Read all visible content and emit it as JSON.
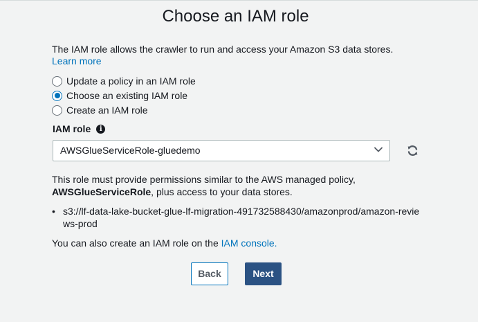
{
  "title": "Choose an IAM role",
  "intro": {
    "text": "The IAM role allows the crawler to run and access your Amazon S3 data stores.",
    "learn_more": "Learn more"
  },
  "options": [
    {
      "label": "Update a policy in an IAM role",
      "checked": false
    },
    {
      "label": "Choose an existing IAM role",
      "checked": true
    },
    {
      "label": "Create an IAM role",
      "checked": false
    }
  ],
  "iam_role": {
    "label": "IAM role",
    "info_icon": "info-icon",
    "selected": "AWSGlueServiceRole-gluedemo",
    "refresh_icon": "refresh-icon"
  },
  "permissions": {
    "text_before": "This role must provide permissions similar to the AWS managed policy,",
    "policy": "AWSGlueServiceRole",
    "text_after": ", plus access to your data stores.",
    "bullet_marker": "•",
    "path": "s3://lf-data-lake-bucket-glue-lf-migration-491732588430/amazonprod/amazon-reviews-prod"
  },
  "console": {
    "text": "You can also create an IAM role on the ",
    "link": "IAM console."
  },
  "buttons": {
    "back": "Back",
    "next": "Next"
  },
  "colors": {
    "accent": "#0073bb",
    "primary_button": "#2b5283",
    "background": "#f2f3f3"
  }
}
